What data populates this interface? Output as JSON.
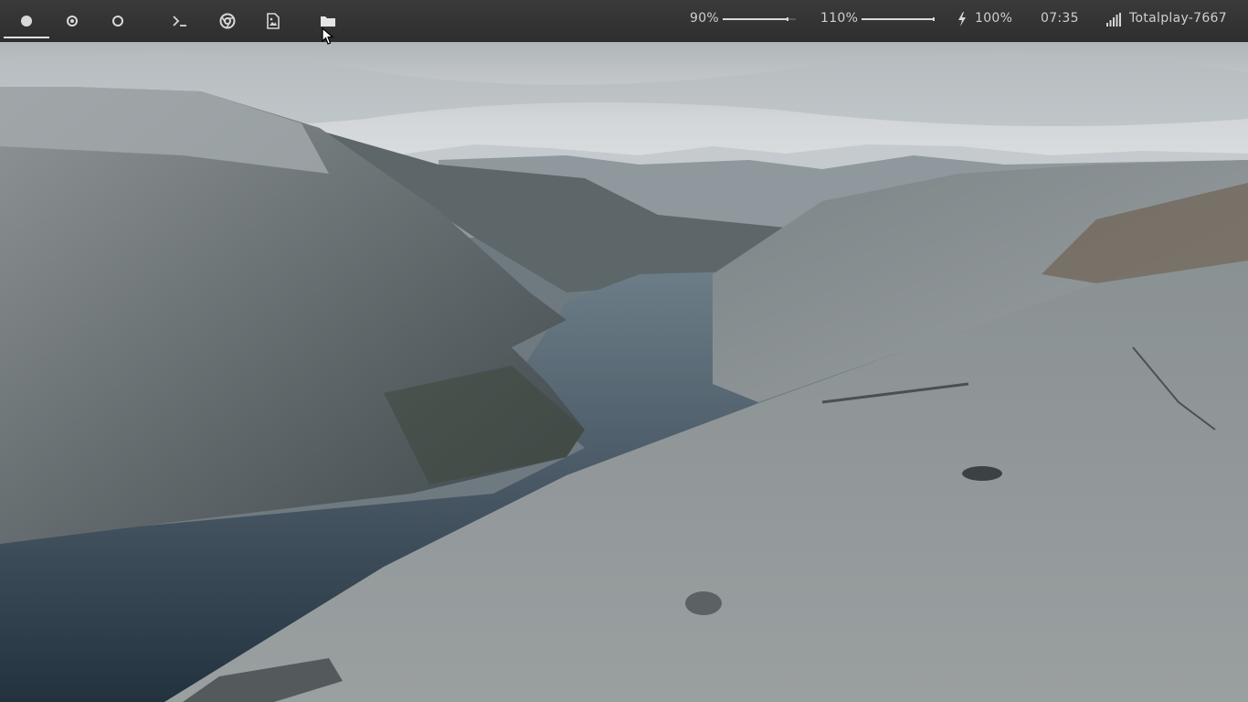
{
  "topbar": {
    "workspaces": [
      {
        "name": "workspace-1",
        "style": "filled",
        "active": true
      },
      {
        "name": "workspace-2",
        "style": "target",
        "active": false
      },
      {
        "name": "workspace-3",
        "style": "hollow",
        "active": false
      }
    ],
    "launchers": [
      {
        "name": "terminal-icon"
      },
      {
        "name": "chrome-icon"
      },
      {
        "name": "image-viewer-icon"
      },
      {
        "name": "folder-icon"
      }
    ],
    "brightness": {
      "label": "90%",
      "level": 0.9
    },
    "volume": {
      "label": "110%",
      "level": 1.0
    },
    "battery": {
      "icon": "bolt-icon",
      "label": "100%"
    },
    "clock": "07:35",
    "network": {
      "icon": "signal-icon",
      "label": "Totalplay-7667"
    }
  },
  "colors": {
    "bar_bg": "#333333",
    "bar_fg": "#d6d6d6",
    "water": "#39495a",
    "rock": "#8c9396",
    "sky": "#c9ced1"
  }
}
